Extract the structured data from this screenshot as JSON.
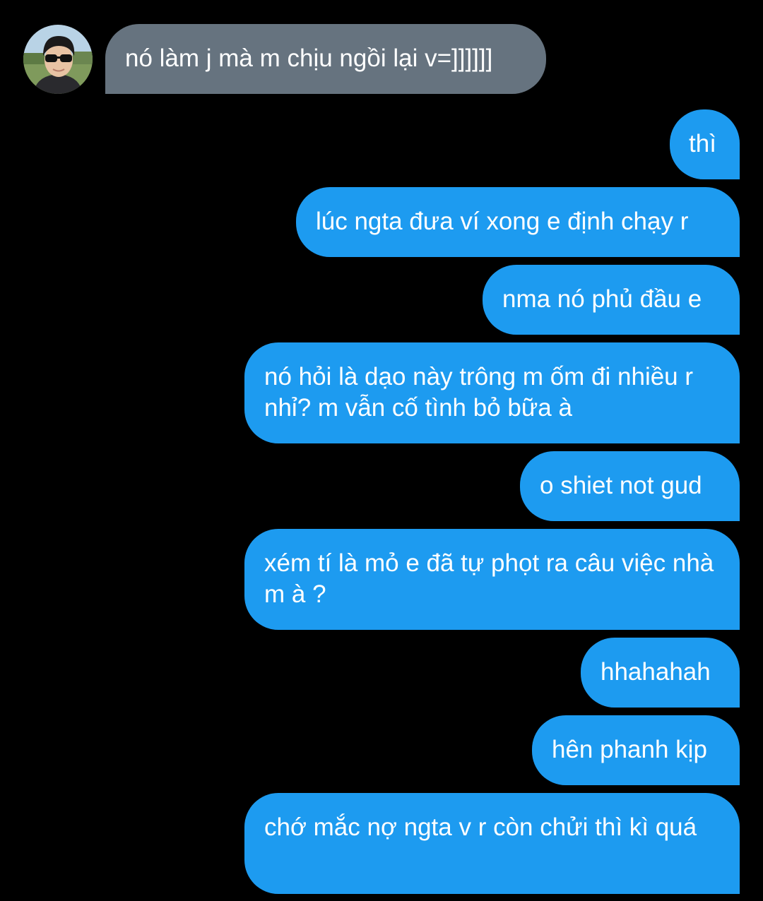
{
  "conversation": {
    "contact": {
      "avatar": "contact-avatar-photo"
    },
    "colors": {
      "background": "#000000",
      "received_bubble": "#66737f",
      "sent_bubble": "#1d9bf0",
      "text": "#ffffff"
    },
    "messages": [
      {
        "direction": "received",
        "text": "nó làm j mà m chịu ngồi lại v=]]]]]]"
      },
      {
        "direction": "sent",
        "text": "thì"
      },
      {
        "direction": "sent",
        "text": "lúc ngta đưa ví xong e định chạy r"
      },
      {
        "direction": "sent",
        "text": "nma nó phủ đầu e"
      },
      {
        "direction": "sent",
        "text": "nó hỏi là dạo này trông m ốm đi nhiều r nhỉ? m vẫn cố tình bỏ bữa à"
      },
      {
        "direction": "sent",
        "text": "o shiet not gud"
      },
      {
        "direction": "sent",
        "text": "xém tí là mỏ e đã tự phọt ra câu việc nhà m à ?"
      },
      {
        "direction": "sent",
        "text": "hhahahah"
      },
      {
        "direction": "sent",
        "text": "hên phanh kịp"
      },
      {
        "direction": "sent",
        "text": "chớ mắc nợ ngta v r còn chửi thì kì quá"
      }
    ]
  }
}
